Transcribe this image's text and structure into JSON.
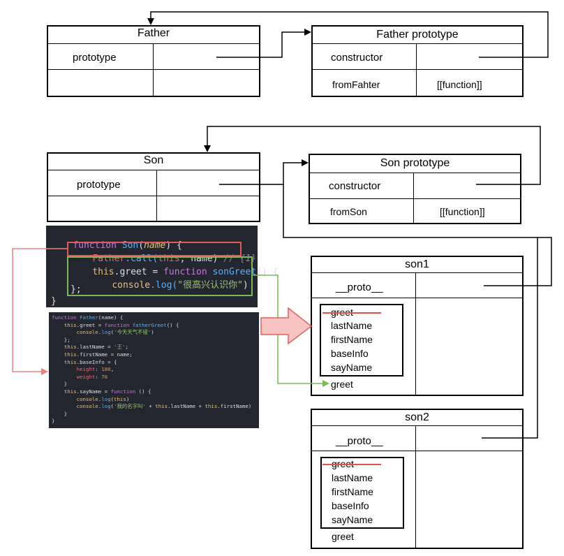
{
  "father": {
    "title": "Father",
    "row1_label": "prototype"
  },
  "father_proto": {
    "title": "Father prototype",
    "row1_label": "constructor",
    "row2_label": "fromFahter",
    "row2_value": "[[function]]"
  },
  "son": {
    "title": "Son",
    "row1_label": "prototype"
  },
  "son_proto": {
    "title": "Son prototype",
    "row1_label": "constructor",
    "row2_label": "fromSon",
    "row2_value": "[[function]]"
  },
  "son1": {
    "title": "son1",
    "proto_label": "__proto__",
    "props": [
      "greet",
      "lastName",
      "firstName",
      "baseInfo",
      "sayName"
    ],
    "own_greet": "greet"
  },
  "son2": {
    "title": "son2",
    "proto_label": "__proto__",
    "props": [
      "greet",
      "lastName",
      "firstName",
      "baseInfo",
      "sayName"
    ],
    "own_greet": "greet"
  },
  "code_son": {
    "l1_kw": "function",
    "l1_name": "Son",
    "l1_param": "name",
    "l1_rest": ") {",
    "l2_obj": "Father",
    "l2_call": ".call(",
    "l2_this": "this",
    "l2_args": ", name)",
    "l2_comment": "// {1}",
    "l3_this": "this",
    "l3_prop": ".greet",
    "l3_eq": " = ",
    "l3_kw": "function",
    "l3_fn": " sonGreet",
    "l3_rest": "() {",
    "l4_obj": "console",
    "l4_fn": ".log(",
    "l4_str": "\"很高兴认识你\"",
    "l4_end": ")",
    "l5": "};",
    "l6": "}"
  },
  "code_father": {
    "lines": [
      "function Father(name) {",
      "    this.greet = function fatherGreet() {",
      "        console.log('今天天气不错')",
      "    };",
      "    this.lastName = '王';",
      "    this.firstName = name;",
      "    this.baseInfo = {",
      "        height: 180,",
      "        weight: 70",
      "    }",
      "    this.sayName = function () {",
      "        console.log(this)",
      "        console.log('我的名字叫' + this.lastName + this.firstName)",
      "    }",
      "}"
    ]
  },
  "colors": {
    "red": "#e8504a",
    "green": "#7ab85a",
    "pink_arrow": "#f5b5b5",
    "code_bg": "#23262e"
  }
}
